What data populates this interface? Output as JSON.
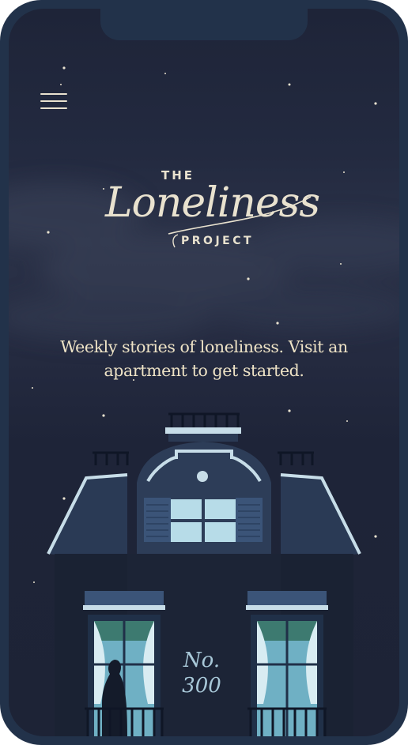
{
  "menu": {
    "icon": "hamburger-menu-icon"
  },
  "logo": {
    "top_text": "THE",
    "script_text": "Loneliness",
    "bottom_text": "PROJECT"
  },
  "tagline": "Weekly stories of loneliness. Visit an apartment to get started.",
  "apartment": {
    "number_label": "No.",
    "number_value": "300"
  },
  "colors": {
    "sky": "#1e2438",
    "frame": "#22324a",
    "text_cream": "#eee3c6",
    "roof_trim": "#a9d3e6",
    "window_light": "#9fd0e0",
    "curtain_green": "#3d7a70"
  }
}
